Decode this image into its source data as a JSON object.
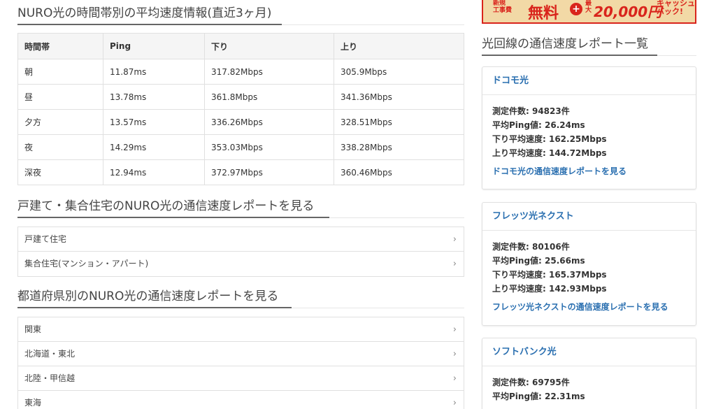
{
  "speed_section": {
    "title": "NURO光の時間帯別の平均速度情報(直近3ヶ月)",
    "headers": [
      "時間帯",
      "Ping",
      "下り",
      "上り"
    ],
    "rows": [
      [
        "朝",
        "11.87ms",
        "317.82Mbps",
        "305.9Mbps"
      ],
      [
        "昼",
        "13.78ms",
        "361.8Mbps",
        "341.36Mbps"
      ],
      [
        "夕方",
        "13.57ms",
        "336.26Mbps",
        "328.51Mbps"
      ],
      [
        "夜",
        "14.29ms",
        "353.03Mbps",
        "338.28Mbps"
      ],
      [
        "深夜",
        "12.94ms",
        "372.97Mbps",
        "360.46Mbps"
      ]
    ]
  },
  "housing_section": {
    "title": "戸建て・集合住宅のNURO光の通信速度レポートを見る",
    "items": [
      "戸建て住宅",
      "集合住宅(マンション・アパート)"
    ]
  },
  "prefecture_section": {
    "title": "都道府県別のNURO光の通信速度レポートを見る",
    "items": [
      "関東",
      "北海道・東北",
      "北陸・甲信越",
      "東海"
    ]
  },
  "banner": {
    "line1": "新規",
    "line2": "工事費",
    "free": "無料",
    "plus": "+",
    "line3": "最",
    "line4": "大",
    "amount": "20,000円",
    "cash1": "キャッシュ",
    "cash2": "バック!"
  },
  "sidebar": {
    "title": "光回線の通信速度レポート一覧",
    "cards": [
      {
        "name": "ドコモ光",
        "count": "測定件数: 94823件",
        "ping": "平均Ping値: 26.24ms",
        "down": "下り平均速度: 162.25Mbps",
        "up": "上り平均速度: 144.72Mbps",
        "link": "ドコモ光の通信速度レポートを見る"
      },
      {
        "name": "フレッツ光ネクスト",
        "count": "測定件数: 80106件",
        "ping": "平均Ping値: 25.66ms",
        "down": "下り平均速度: 165.37Mbps",
        "up": "上り平均速度: 142.93Mbps",
        "link": "フレッツ光ネクストの通信速度レポートを見る"
      },
      {
        "name": "ソフトバンク光",
        "count": "測定件数: 69795件",
        "ping": "平均Ping値: 22.31ms"
      }
    ]
  },
  "colors": {
    "link": "#2a6fb0",
    "banner_red": "#d9241c",
    "banner_bg": "#f2d9a6"
  }
}
